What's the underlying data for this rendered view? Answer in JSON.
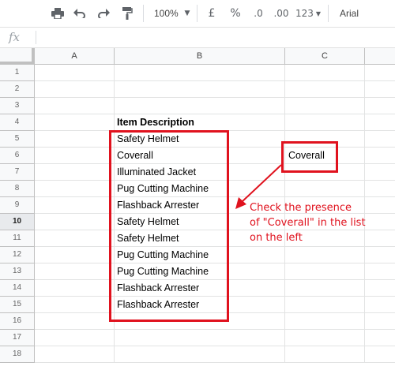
{
  "toolbar": {
    "print_icon": "printer-icon",
    "undo_icon": "undo-icon",
    "redo_icon": "redo-icon",
    "paint_format_icon": "paint-format-icon",
    "zoom": "100%",
    "currency": "£",
    "percent": "%",
    "decrease_decimal": ".0",
    "increase_decimal": ".00",
    "more_formats": "123",
    "font": "Arial"
  },
  "formula_bar": {
    "label": "fx",
    "value": ""
  },
  "columns": [
    "A",
    "B",
    "C"
  ],
  "rows": [
    "1",
    "2",
    "3",
    "4",
    "5",
    "6",
    "7",
    "8",
    "9",
    "10",
    "11",
    "12",
    "13",
    "14",
    "15",
    "16",
    "17",
    "18"
  ],
  "selected_row": "10",
  "cells": {
    "B4": "Item Description",
    "B5": "Safety Helmet",
    "B6": "Coverall",
    "B7": "Illuminated Jacket",
    "B8": "Pug Cutting Machine",
    "B9": "Flashback Arrester",
    "B10": "Safety Helmet",
    "B11": "Safety Helmet",
    "B12": "Pug Cutting Machine",
    "B13": "Pug Cutting Machine",
    "B14": "Flashback Arrester",
    "B15": "Flashback Arrester",
    "C6": "Coverall"
  },
  "annotation": {
    "line1": "Check the presence",
    "line2": "of \"Coverall\" in the list",
    "line3": "on the left",
    "color": "#e0121e"
  }
}
